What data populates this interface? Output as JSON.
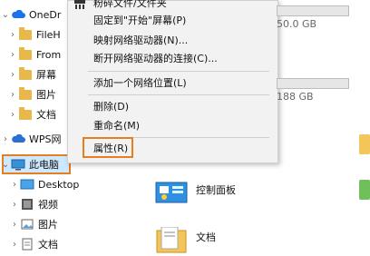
{
  "sidebar": {
    "onedrive_label": "OneDr",
    "items": [
      {
        "label": "FileH"
      },
      {
        "label": "From"
      },
      {
        "label": "屏幕"
      },
      {
        "label": "图片"
      },
      {
        "label": "文档"
      }
    ],
    "wps_label": "WPS网",
    "this_pc_label": "此电脑",
    "pc_children": [
      {
        "label": "Desktop"
      },
      {
        "label": "视频"
      },
      {
        "label": "图片"
      },
      {
        "label": "文档"
      }
    ]
  },
  "context_menu": {
    "items": [
      {
        "label": "粉碎文件/文件夹"
      },
      {
        "label": "固定到\"开始\"屏幕(P)"
      },
      {
        "label": "映射网络驱动器(N)..."
      },
      {
        "label": "断开网络驱动器的连接(C)..."
      },
      {
        "label": "添加一个网络位置(L)"
      },
      {
        "label": "删除(D)"
      },
      {
        "label": "重命名(M)"
      },
      {
        "label": "属性(R)"
      }
    ]
  },
  "main": {
    "drive1_free": "50.0 GB",
    "drive2_free": "188 GB",
    "control_panel_label": "控制面板",
    "documents_label": "文档"
  },
  "colors": {
    "highlight_box": "#e67e22",
    "selection_bg": "#cde8ff",
    "folder": "#e8b94a"
  }
}
